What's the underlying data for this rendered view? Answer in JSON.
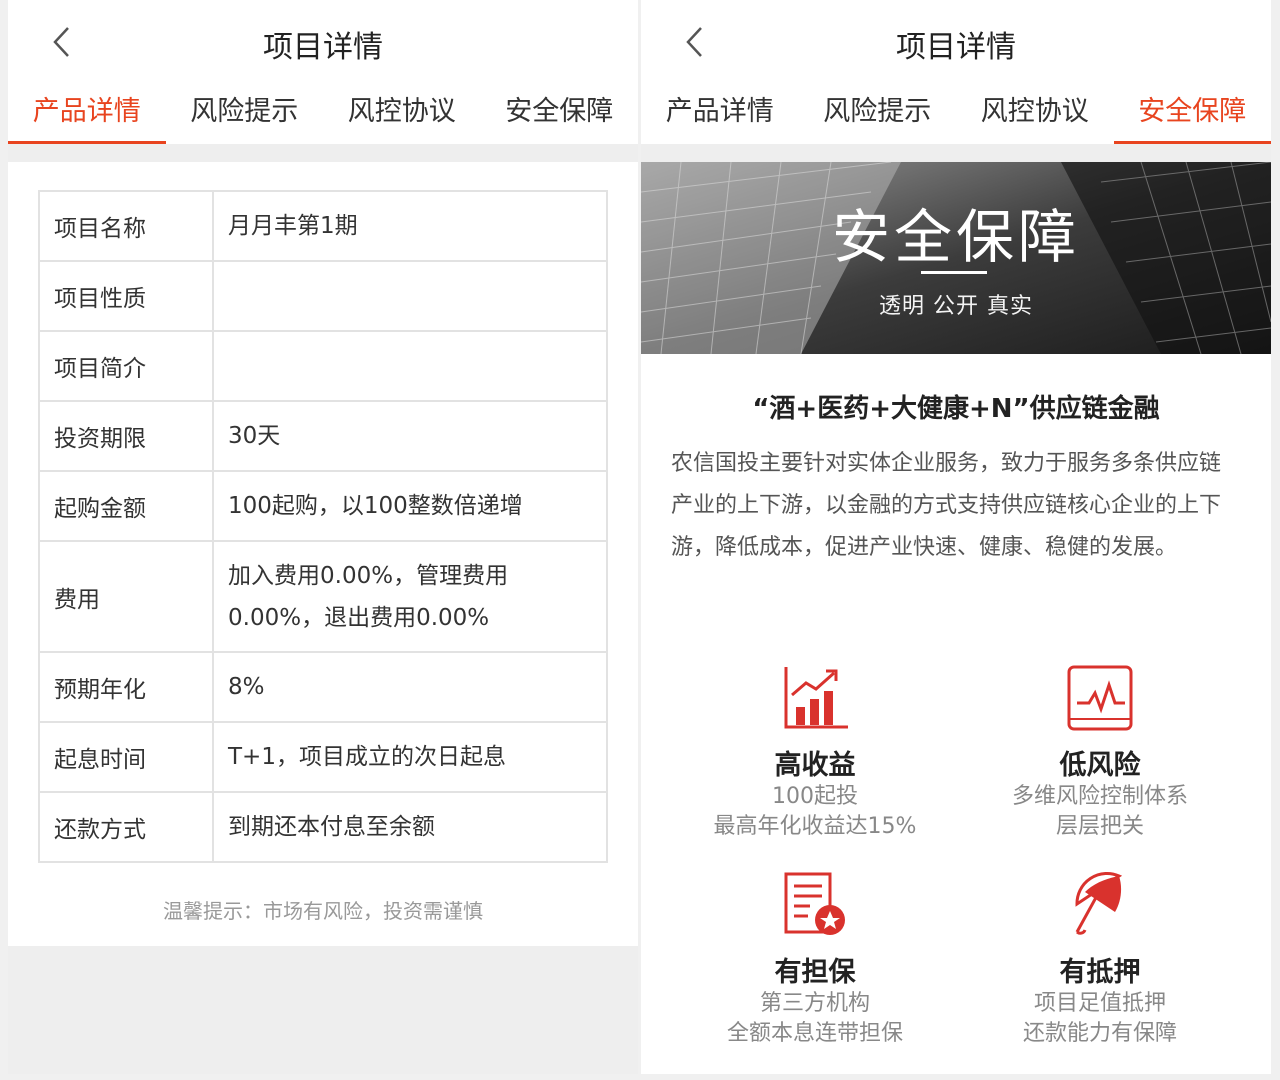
{
  "accent_color": "#e8441f",
  "left": {
    "title": "项目详情",
    "tabs": [
      "产品详情",
      "风险提示",
      "风控协议",
      "安全保障"
    ],
    "active_tab": 0,
    "table": [
      {
        "k": "项目名称",
        "v": "月月丰第1期"
      },
      {
        "k": "项目性质",
        "v": ""
      },
      {
        "k": "项目简介",
        "v": ""
      },
      {
        "k": "投资期限",
        "v": "30天"
      },
      {
        "k": "起购金额",
        "v": "100起购，以100整数倍递增"
      },
      {
        "k": "费用",
        "v1": "加入费用0.00%，管理费用",
        "v2": "0.00%，退出费用0.00%"
      },
      {
        "k": "预期年化",
        "v": "8%"
      },
      {
        "k": "起息时间",
        "v": "T+1，项目成立的次日起息"
      },
      {
        "k": "还款方式",
        "v": "到期还本付息至余额"
      }
    ],
    "tip": "温馨提示：市场有风险，投资需谨慎"
  },
  "right": {
    "title": "项目详情",
    "tabs": [
      "产品详情",
      "风险提示",
      "风控协议",
      "安全保障"
    ],
    "active_tab": 3,
    "banner": {
      "title": "安全保障",
      "subtitle": "透明 公开 真实"
    },
    "section_title": "“酒+医药+大健康+N”供应链金融",
    "description": "农信国投主要针对实体企业服务，致力于服务多条供应链产业的上下游，以金融的方式支持供应链核心企业的上下游，降低成本，促进产业快速、健康、稳健的发展。",
    "features": [
      {
        "icon": "bar-chart-icon",
        "name": "高收益",
        "line1": "100起投",
        "line2": "最高年化收益达15%"
      },
      {
        "icon": "line-chart-icon",
        "name": "低风险",
        "line1": "多维风险控制体系",
        "line2": "层层把关"
      },
      {
        "icon": "document-star-icon",
        "name": "有担保",
        "line1": "第三方机构",
        "line2": "全额本息连带担保"
      },
      {
        "icon": "umbrella-icon",
        "name": "有抵押",
        "line1": "项目足值抵押",
        "line2": "还款能力有保障"
      }
    ]
  }
}
